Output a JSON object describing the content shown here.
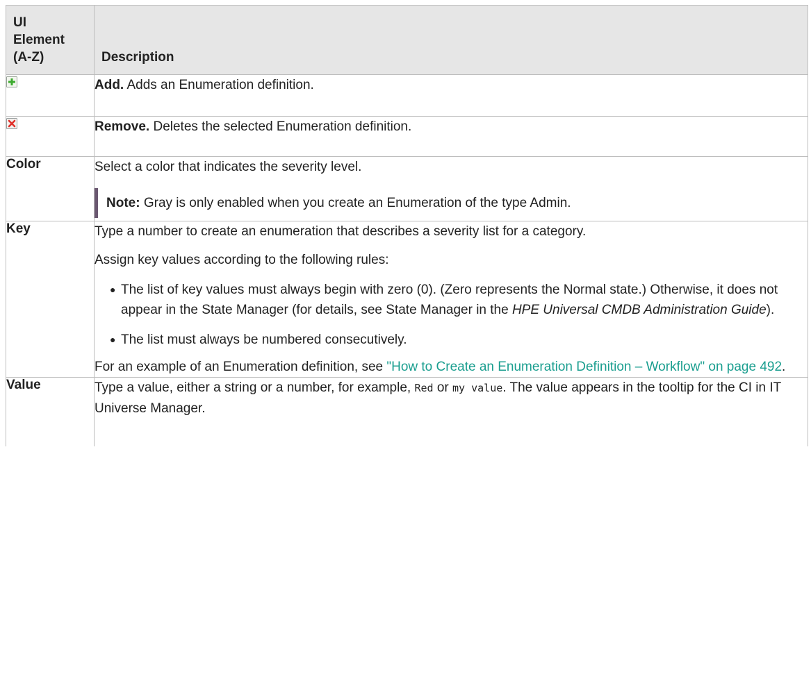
{
  "table": {
    "header": {
      "col1": "UI Element (A-Z)",
      "col1_lines": [
        "UI",
        "Element",
        "(A-Z)"
      ],
      "col2": "Description"
    },
    "rows": {
      "add": {
        "icon": "add-plus-icon",
        "label": "Add.",
        "text": "Adds an Enumeration definition."
      },
      "remove": {
        "icon": "remove-x-icon",
        "label": "Remove.",
        "text": "Deletes the selected Enumeration definition."
      },
      "color": {
        "element": "Color",
        "text": "Select a color that indicates the severity level.",
        "note_label": "Note:",
        "note_text": "Gray is only enabled when you create an Enumeration of the type Admin."
      },
      "key": {
        "element": "Key",
        "text1": "Type a number to create an enumeration that describes a severity list for a category.",
        "text2": "Assign key values according to the following rules:",
        "bullet1_part1": "The list of key values must always begin with zero (0). (Zero represents the Normal state.) Otherwise, it does not appear in the State Manager (for details, see State Manager in the ",
        "bullet1_italic": "HPE Universal CMDB Administration Guide",
        "bullet1_part2": ").",
        "bullet2": "The list must always be numbered consecutively.",
        "example_prefix": "For an example of an Enumeration definition, see ",
        "example_link": "\"How to Create an Enumeration Definition – Workflow\" on page 492",
        "example_suffix": "."
      },
      "value": {
        "element": "Value",
        "text_part1": "Type a value, either a string or a number, for example, ",
        "code1": "Red",
        "text_part2": " or ",
        "code2": "my value",
        "text_part3": ". The value appears in the tooltip for the CI in IT Universe Manager."
      }
    }
  },
  "colors": {
    "header_bg": "#e6e6e6",
    "border": "#bdbdbd",
    "link": "#1a9e8f",
    "note_bar": "#6a5770",
    "add_icon_green": "#3cab2e",
    "remove_icon_red": "#e0302a"
  }
}
